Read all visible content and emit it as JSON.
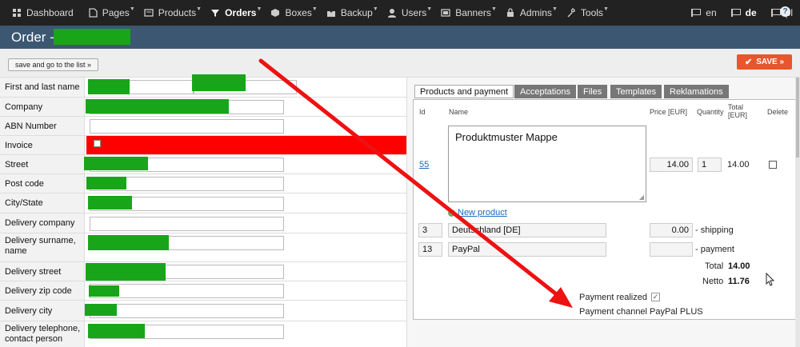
{
  "nav": {
    "items": [
      {
        "label": "Dashboard",
        "icon": "dashboard-icon",
        "caret": false,
        "active": false
      },
      {
        "label": "Pages",
        "icon": "pages-icon",
        "caret": true,
        "active": false
      },
      {
        "label": "Products",
        "icon": "products-icon",
        "caret": true,
        "active": false
      },
      {
        "label": "Orders",
        "icon": "orders-icon",
        "caret": true,
        "active": true
      },
      {
        "label": "Boxes",
        "icon": "boxes-icon",
        "caret": true,
        "active": false
      },
      {
        "label": "Backup",
        "icon": "backup-icon",
        "caret": true,
        "active": false
      },
      {
        "label": "Users",
        "icon": "users-icon",
        "caret": true,
        "active": false
      },
      {
        "label": "Banners",
        "icon": "banners-icon",
        "caret": true,
        "active": false
      },
      {
        "label": "Admins",
        "icon": "admins-icon",
        "caret": true,
        "active": false
      },
      {
        "label": "Tools",
        "icon": "tools-icon",
        "caret": true,
        "active": false
      }
    ],
    "languages": [
      {
        "label": "en",
        "active": false
      },
      {
        "label": "de",
        "active": true
      },
      {
        "label": "pl",
        "active": false
      }
    ]
  },
  "header": {
    "title": "Order -",
    "help_icon": "?"
  },
  "toolbar": {
    "save_list_label": "save and go to the list »",
    "save_label": "SAVE »"
  },
  "form": {
    "first_last_name_label": "First and last name",
    "company_label": "Company",
    "abn_label": "ABN Number",
    "invoice_label": "Invoice",
    "street_label": "Street",
    "post_code_label": "Post code",
    "city_state_label": "City/State",
    "delivery_company_label": "Delivery company",
    "delivery_surname_label": "Delivery surname, name",
    "delivery_street_label": "Delivery street",
    "delivery_zip_label": "Delivery zip code",
    "delivery_city_label": "Delivery city",
    "delivery_phone_label": "Delivery telephone, contact person"
  },
  "tabs": [
    "Products and payment",
    "Acceptations",
    "Files",
    "Templates",
    "Reklamations"
  ],
  "products": {
    "col_id": "Id",
    "col_name": "Name",
    "col_price": "Price [EUR]",
    "col_quantity": "Quantity",
    "col_total": "Total [EUR]",
    "col_delete": "Delete",
    "item_id": "55",
    "item_name": "Produktmuster Mappe",
    "item_price": "14.00",
    "item_qty": "1",
    "item_total": "14.00",
    "new_product_label": "New product",
    "shipping_id": "3",
    "shipping_name": "Deutschland [DE]",
    "shipping_price": "0.00",
    "shipping_label": "- shipping",
    "payment_id": "13",
    "payment_name": "PayPal",
    "payment_price": "",
    "payment_label": "- payment",
    "total_label": "Total",
    "total_value": "14.00",
    "netto_label": "Netto",
    "netto_value": "11.76",
    "payment_realized_label": "Payment realized",
    "payment_realized": true,
    "payment_channel_label": "Payment channel",
    "payment_channel_value": "PayPal PLUS"
  },
  "colors": {
    "redaction": "#19a519",
    "invoice_highlight": "#ff0000",
    "arrow": "#ee1111",
    "save": "#e8562e",
    "titlebar": "#3c5772"
  }
}
